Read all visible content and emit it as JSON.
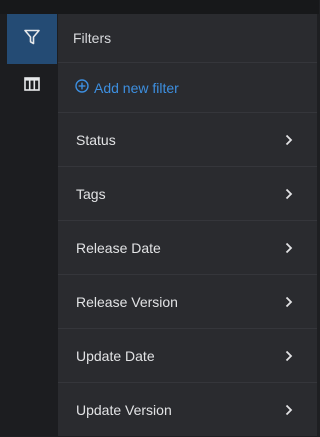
{
  "panel": {
    "title": "Filters",
    "add_filter_label": "Add new filter",
    "accent_color": "#3d8fe0",
    "items": [
      {
        "label": "Status"
      },
      {
        "label": "Tags"
      },
      {
        "label": "Release Date"
      },
      {
        "label": "Release Version"
      },
      {
        "label": "Update Date"
      },
      {
        "label": "Update Version"
      }
    ]
  },
  "rail": {
    "buttons": [
      {
        "icon": "filter-icon",
        "active": true,
        "active_color": "#244b74"
      },
      {
        "icon": "columns-icon",
        "active": false
      }
    ]
  }
}
